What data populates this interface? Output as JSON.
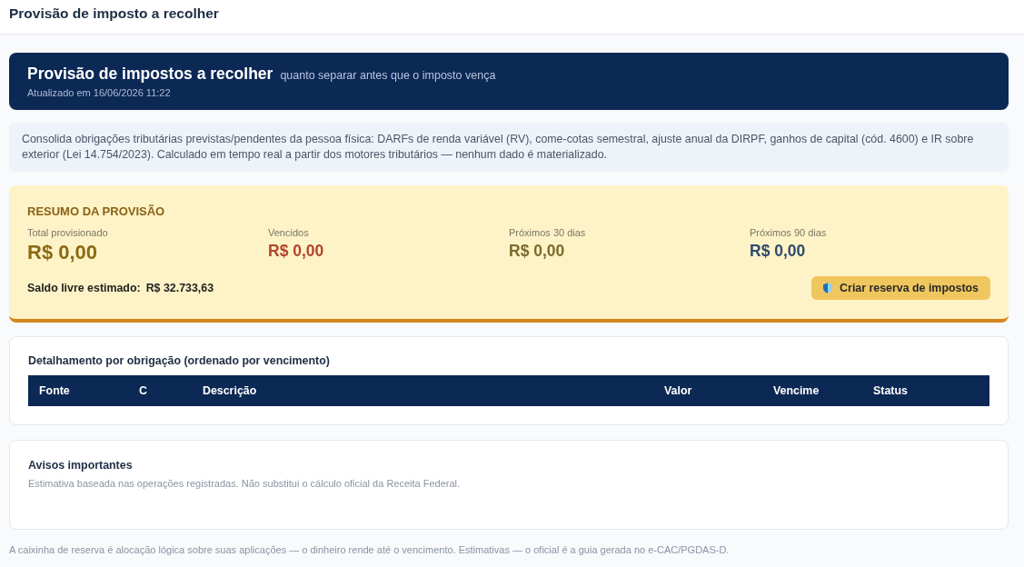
{
  "header": {
    "title": "Provisão de imposto a recolher"
  },
  "hero": {
    "title": "Provisão de impostos a recolher",
    "subtitle": "quanto separar antes que o imposto vença",
    "updated": "Atualizado em 16/06/2026 11:22"
  },
  "info": {
    "text": "Consolida obrigações tributárias previstas/pendentes da pessoa física: DARFs de renda variável (RV), come-cotas semestral, ajuste anual da DIRPF, ganhos de capital (cód. 4600) e IR sobre exterior (Lei 14.754/2023). Calculado em tempo real a partir dos motores tributários — nenhum dado é materializado."
  },
  "summary": {
    "title": "RESUMO DA PROVISÃO",
    "metrics": [
      {
        "label": "Total provisionado",
        "value": "R$ 0,00",
        "kind": "main",
        "color": "#8b6914"
      },
      {
        "label": "Vencidos",
        "value": "R$ 0,00",
        "kind": "regular",
        "color": "#b0452c"
      },
      {
        "label": "Próximos 30 dias",
        "value": "R$ 0,00",
        "kind": "regular",
        "color": "#7d6a2c"
      },
      {
        "label": "Próximos 90 dias",
        "value": "R$ 0,00",
        "kind": "regular",
        "color": "#2d4b6e"
      }
    ],
    "free_balance": {
      "label": "Saldo livre estimado:",
      "value": "R$ 32.733,63"
    },
    "button": {
      "label": "Criar reserva de impostos"
    }
  },
  "obligations": {
    "title": "Detalhamento por obrigação (ordenado por vencimento)",
    "columns": [
      "Fonte",
      "C",
      "Descrição",
      "Valor",
      "Vencime",
      "Status"
    ]
  },
  "notices": {
    "title": "Avisos importantes",
    "text": "Estimativa baseada nas operações registradas. Não substitui o cálculo oficial da Receita Federal."
  },
  "footer": {
    "text": "A caixinha de reserva é alocação lógica sobre suas aplicações — o dinheiro rende até o vencimento. Estimativas — o oficial é a guia gerada no e-CAC/PGDAS-D."
  }
}
